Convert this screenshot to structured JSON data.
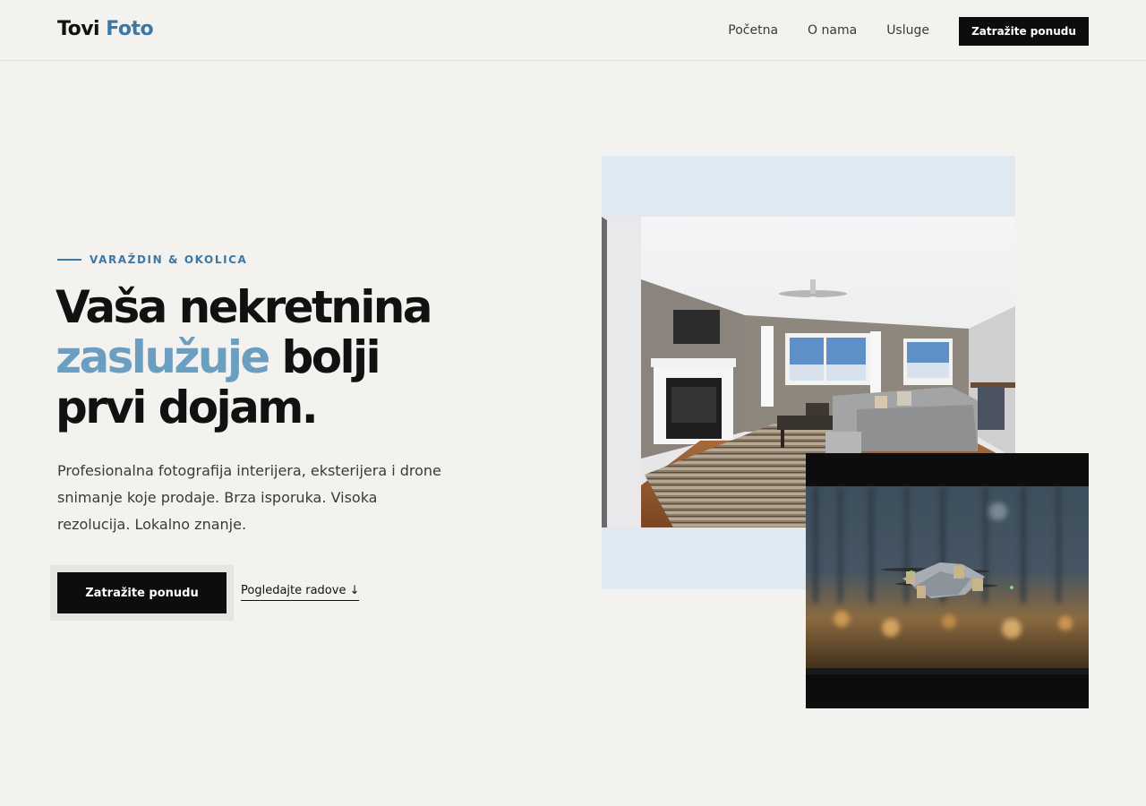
{
  "nav": {
    "logo_part1": "Tovi",
    "logo_part2": "Foto",
    "links": [
      "Početna",
      "O nama",
      "Usluge"
    ],
    "cta": "Zatražite ponudu"
  },
  "hero": {
    "eyebrow": "VARAŽDIN & OKOLICA",
    "headline_line1": "Vaša nekretnina",
    "headline_accent": "zaslužuje",
    "headline_after_accent": "bolji",
    "headline_line3": "prvi dojam.",
    "lead": "Profesionalna fotografija interijera, eksterijera i drone snimanje koje prodaje. Brza isporuka. Visoka rezolucija. Lokalno znanje.",
    "cta_primary": "Zatražite ponudu",
    "cta_secondary": "Pogledajte radove ↓"
  },
  "colors": {
    "accent": "#3a78a8",
    "accent_light": "#6a9fc2",
    "background": "#f3f2ef",
    "dark": "#0d0d0d",
    "photo_frame": "#dfe9f1"
  }
}
